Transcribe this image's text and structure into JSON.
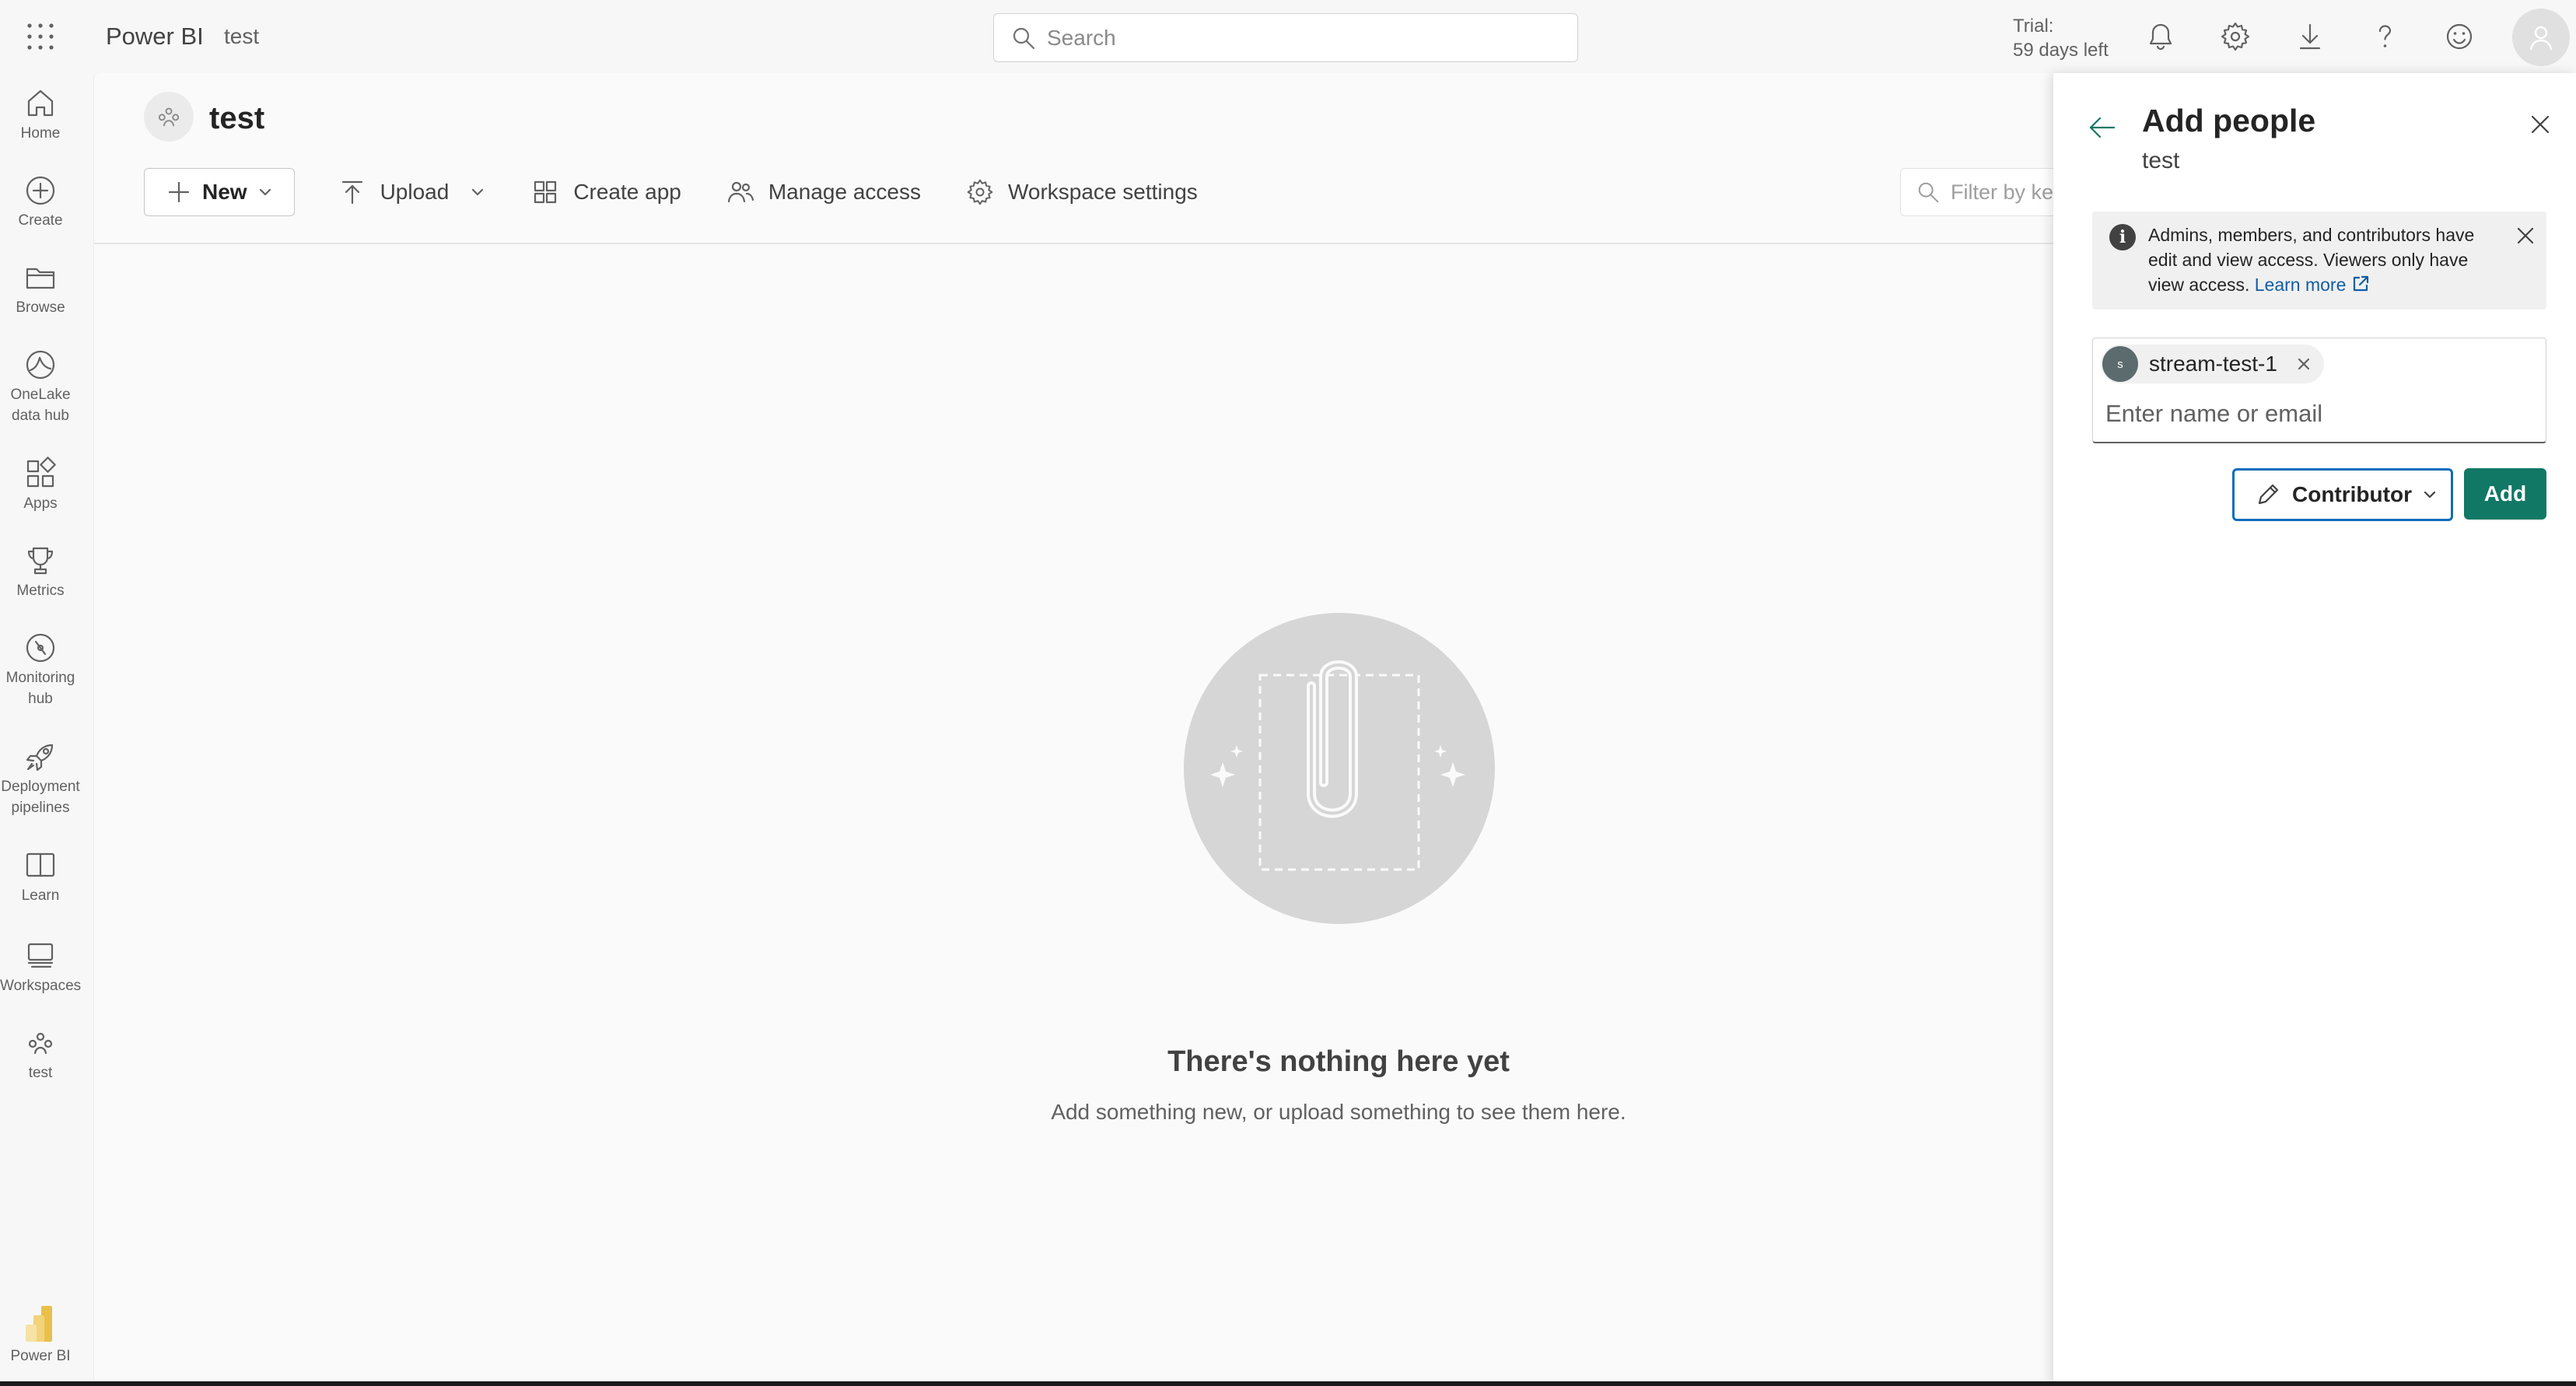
{
  "header": {
    "app_name": "Power BI",
    "breadcrumb": "test",
    "search_placeholder": "Search",
    "trial_line1": "Trial:",
    "trial_line2": "59 days left",
    "icons": [
      "waffle-icon",
      "bell-icon",
      "gear-icon",
      "download-icon",
      "help-icon",
      "feedback-icon",
      "account-icon"
    ]
  },
  "leftnav": {
    "items": [
      {
        "label": "Home",
        "icon": "home-icon"
      },
      {
        "label": "Create",
        "icon": "plus-circle-icon"
      },
      {
        "label": "Browse",
        "icon": "folder-icon"
      },
      {
        "label": "OneLake\ndata hub",
        "icon": "onelake-icon"
      },
      {
        "label": "Apps",
        "icon": "apps-icon"
      },
      {
        "label": "Metrics",
        "icon": "trophy-icon"
      },
      {
        "label": "Monitoring\nhub",
        "icon": "monitoring-icon"
      },
      {
        "label": "Deployment\npipelines",
        "icon": "rocket-icon"
      },
      {
        "label": "Learn",
        "icon": "book-icon"
      },
      {
        "label": "Workspaces",
        "icon": "workspaces-icon"
      },
      {
        "label": "test",
        "icon": "workspace-icon"
      }
    ],
    "footer_label": "Power BI"
  },
  "workspace": {
    "title": "test",
    "toolbar": {
      "new_label": "New",
      "upload_label": "Upload",
      "create_app_label": "Create app",
      "manage_access_label": "Manage access",
      "workspace_settings_label": "Workspace settings"
    },
    "filter_placeholder": "Filter by keyword"
  },
  "empty_state": {
    "title": "There's nothing here yet",
    "subtitle": "Add something new, or upload something to see them here."
  },
  "panel": {
    "title": "Add people",
    "subtitle": "test",
    "info_text": "Admins, members, and contributors have edit and view access. Viewers only have view access.",
    "info_link": "Learn more",
    "chip": {
      "initial": "s",
      "name": "stream-test-1"
    },
    "input_placeholder": "Enter name or email",
    "role_label": "Contributor",
    "add_label": "Add"
  },
  "colors": {
    "accent_green": "#117865",
    "focus_blue": "#0f6cbd",
    "link_blue": "#115ea3"
  }
}
